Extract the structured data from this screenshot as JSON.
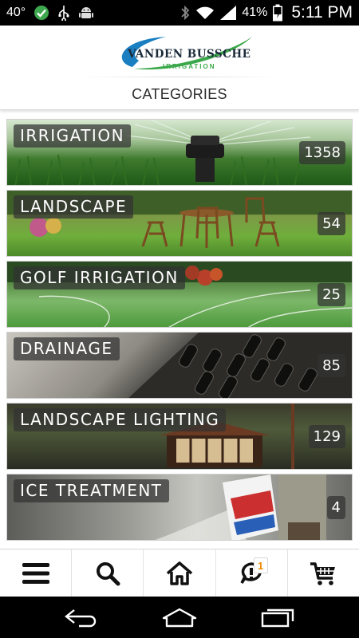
{
  "status_bar": {
    "temperature": "40°",
    "battery_percent": "41%",
    "time": "5:11 PM",
    "icons": [
      "check-circle-icon",
      "usb-icon",
      "android-icon",
      "bluetooth-icon",
      "wifi-icon",
      "signal-icon",
      "battery-icon"
    ]
  },
  "header": {
    "logo_text": "VANDEN BUSSCHE",
    "logo_subtext": "IRRIGATION",
    "title": "CATEGORIES"
  },
  "categories": [
    {
      "name": "IRRIGATION",
      "count": "1358"
    },
    {
      "name": "LANDSCAPE",
      "count": "54"
    },
    {
      "name": "GOLF IRRIGATION",
      "count": "25"
    },
    {
      "name": "DRAINAGE",
      "count": "85"
    },
    {
      "name": "LANDSCAPE LIGHTING",
      "count": "129"
    },
    {
      "name": "ICE TREATMENT",
      "count": "4"
    }
  ],
  "bottom_nav": {
    "items": [
      "menu-icon",
      "search-icon",
      "home-icon",
      "notifications-icon",
      "cart-icon"
    ],
    "notification_badge": "1"
  },
  "system_nav": {
    "items": [
      "back-icon",
      "home-icon",
      "recents-icon"
    ]
  },
  "colors": {
    "logo_blue": "#1a7fc1",
    "logo_green": "#3aa84a",
    "badge_orange": "#f08a00"
  }
}
